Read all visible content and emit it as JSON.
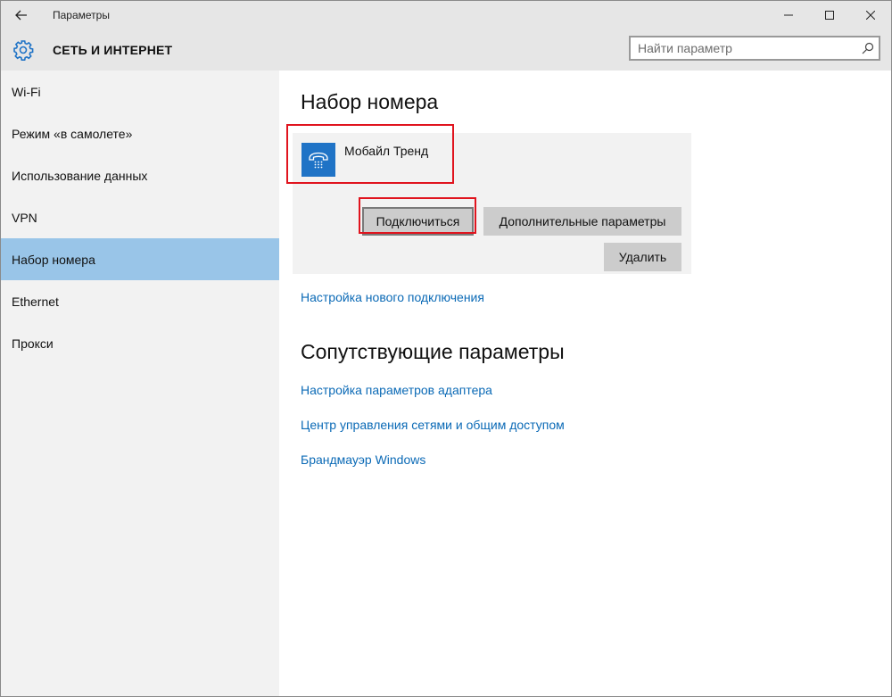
{
  "window": {
    "title": "Параметры",
    "controls": {
      "minimize": "—",
      "maximize": "☐",
      "close": "✕"
    }
  },
  "header": {
    "title": "СЕТЬ И ИНТЕРНЕТ",
    "search_placeholder": "Найти параметр",
    "icon": "gear-icon"
  },
  "sidebar": {
    "items": [
      {
        "label": "Wi-Fi"
      },
      {
        "label": "Режим «в самолете»"
      },
      {
        "label": "Использование данных"
      },
      {
        "label": "VPN"
      },
      {
        "label": "Набор номера",
        "active": true
      },
      {
        "label": "Ethernet"
      },
      {
        "label": "Прокси"
      }
    ]
  },
  "main": {
    "title": "Набор номера",
    "connection": {
      "name": "Мобайл Тренд",
      "icon": "dialup-phone-icon",
      "connect_label": "Подключиться",
      "advanced_label": "Дополнительные параметры",
      "delete_label": "Удалить"
    },
    "new_connection_link": "Настройка нового подключения",
    "related_title": "Сопутствующие параметры",
    "related_links": [
      "Настройка параметров адаптера",
      "Центр управления сетями и общим доступом",
      "Брандмауэр Windows"
    ]
  },
  "colors": {
    "accent": "#1f73c6",
    "link": "#0b6ab6",
    "active_item": "#99c5e8",
    "highlight": "#e0141e"
  }
}
